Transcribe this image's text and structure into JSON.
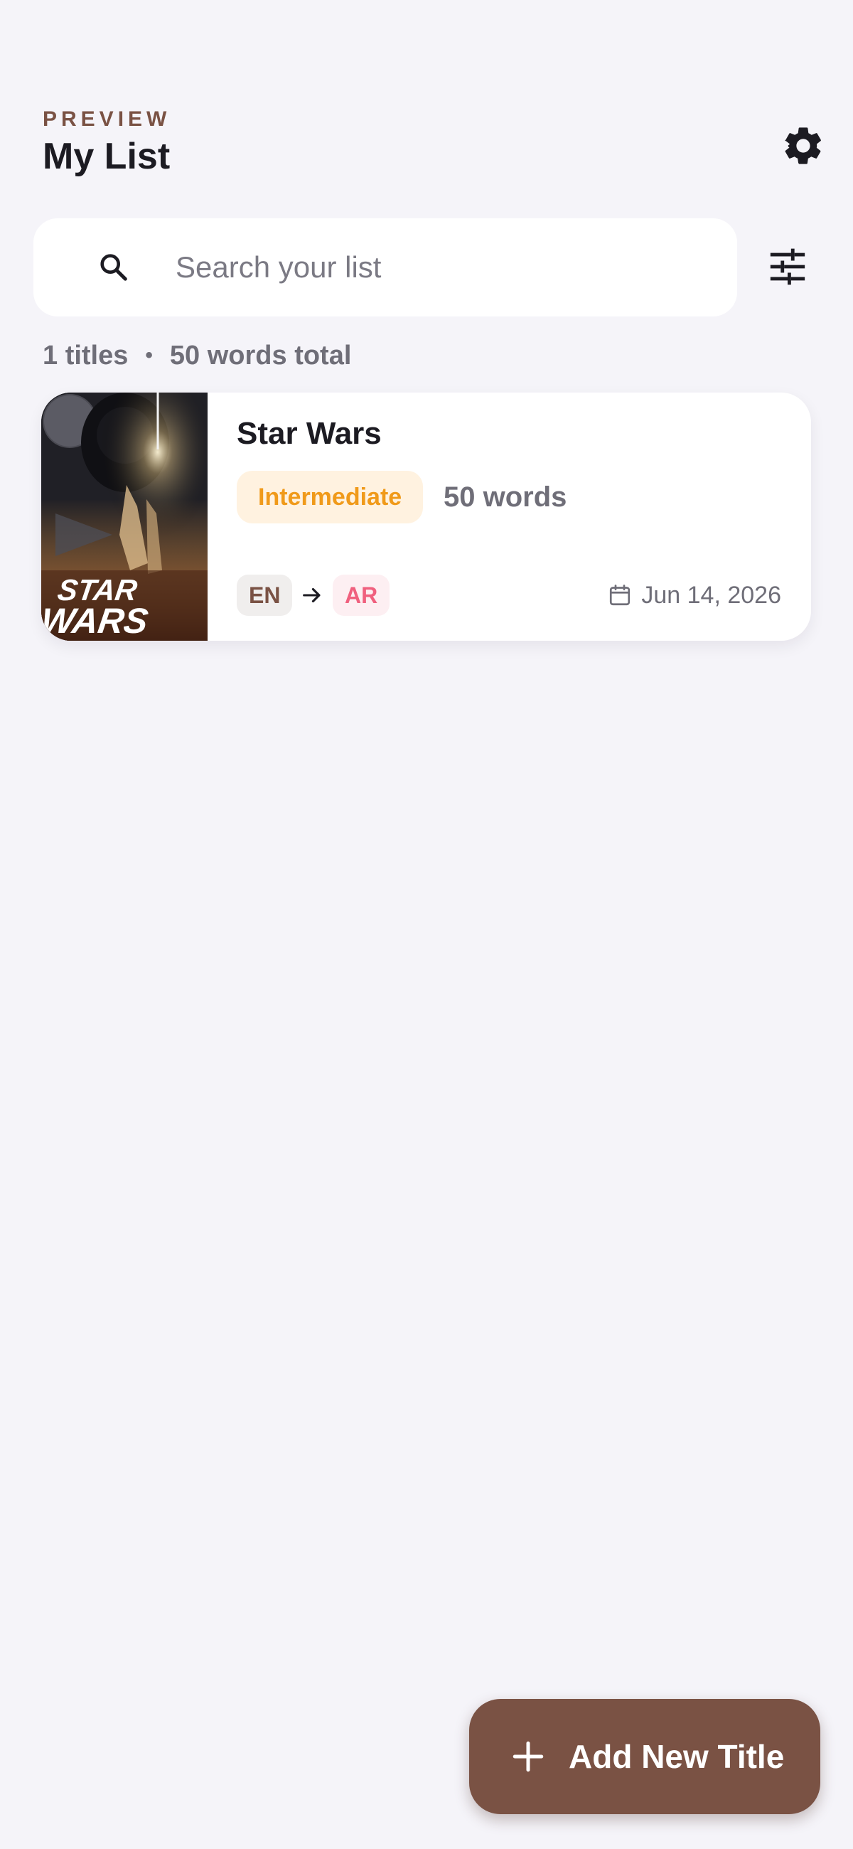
{
  "header": {
    "eyebrow": "PREVIEW",
    "title": "My List"
  },
  "search": {
    "placeholder": "Search your list",
    "value": ""
  },
  "summary": {
    "titles": "1 titles",
    "separator": "•",
    "words_total": "50 words total"
  },
  "list": {
    "items": [
      {
        "title": "Star Wars",
        "level": "Intermediate",
        "word_count": "50 words",
        "source_lang": "EN",
        "target_lang": "AR",
        "date": "Jun 14, 2026",
        "poster_logo": "STAR WARS"
      }
    ]
  },
  "fab": {
    "label": "Add New Title"
  },
  "icons": {
    "settings": "gear-icon",
    "search": "search-icon",
    "filter": "sliders-icon",
    "arrow": "arrow-right-icon",
    "calendar": "calendar-icon",
    "add": "plus-icon"
  },
  "colors": {
    "background": "#f5f4f9",
    "accent": "#7a5244",
    "level_badge_text": "#f09a1a",
    "level_badge_bg": "#fff2e0",
    "target_lang_text": "#f0607e",
    "target_lang_bg": "#fdeff2",
    "muted_text": "#6f6e78"
  }
}
